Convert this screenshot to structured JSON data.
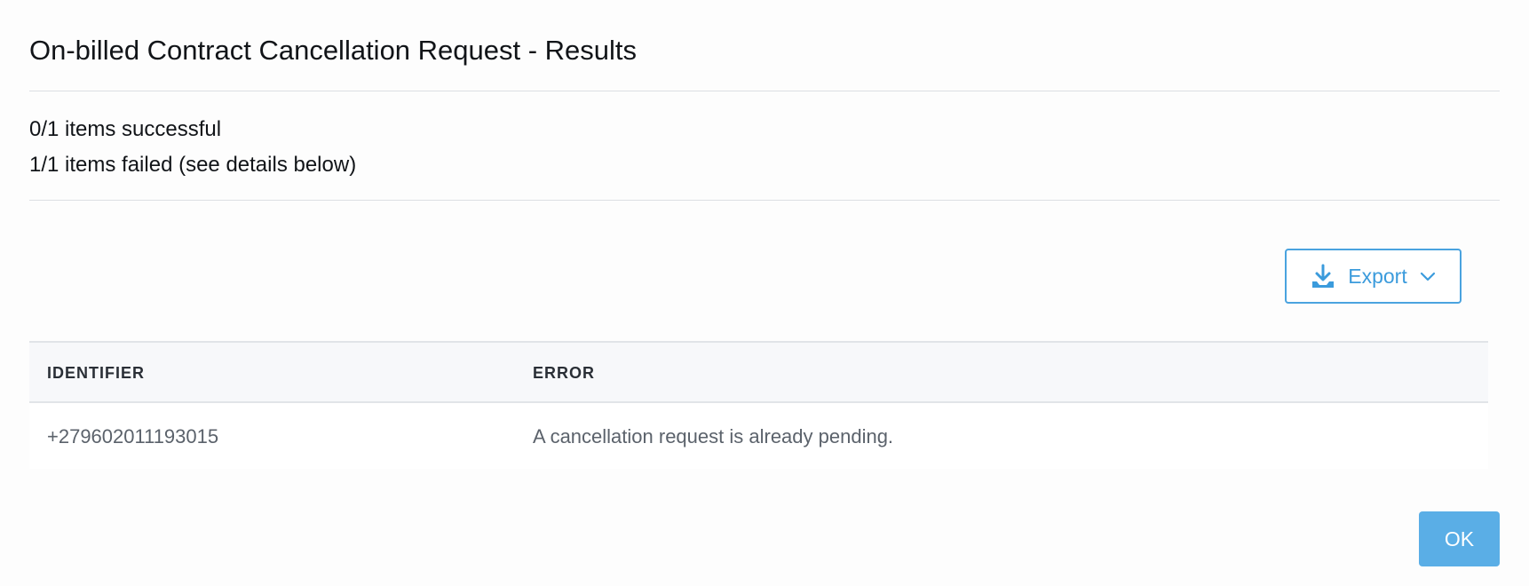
{
  "dialog": {
    "title": "On-billed Contract Cancellation Request - Results"
  },
  "summary": {
    "success_text": "0/1 items successful",
    "failed_text": "1/1 items failed (see details below)"
  },
  "toolbar": {
    "export_label": "Export",
    "export_icon": "download-icon",
    "chevron_icon": "chevron-down-icon"
  },
  "table": {
    "columns": [
      "IDENTIFIER",
      "ERROR"
    ],
    "rows": [
      [
        "+279602011193015",
        "A cancellation request is already pending."
      ]
    ]
  },
  "footer": {
    "ok_label": "OK"
  },
  "colors": {
    "accent": "#4aa3df",
    "ok_button": "#5aaee6"
  }
}
